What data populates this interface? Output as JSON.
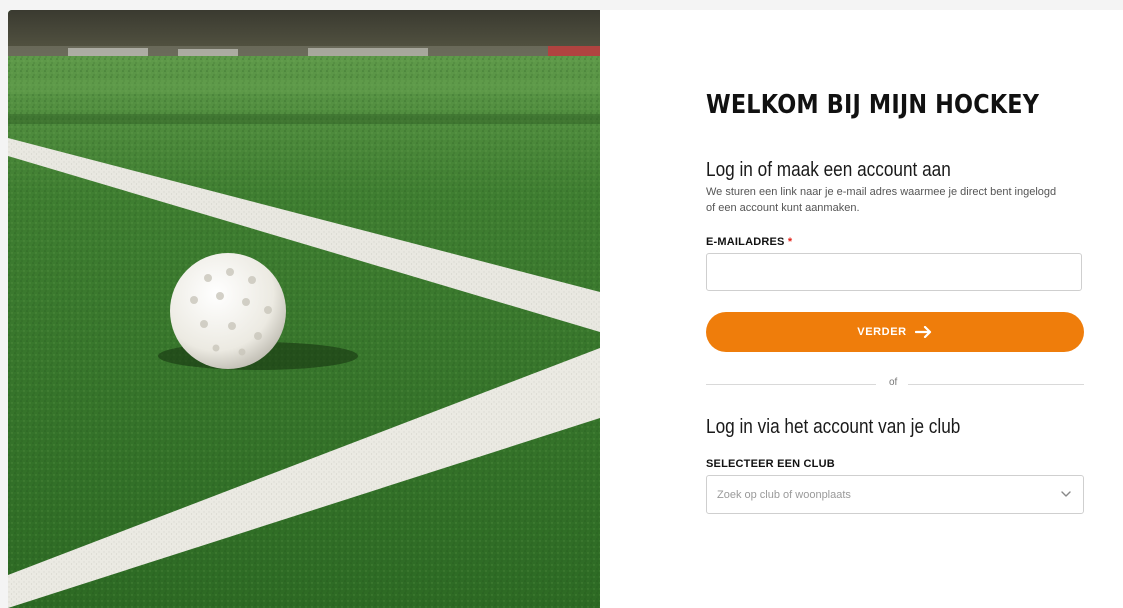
{
  "header": {
    "title": "WELKOM BIJ MIJN HOCKEY"
  },
  "email_login": {
    "heading": "Log in of maak een account aan",
    "description": "We sturen een link naar je e-mail adres waarmee je direct bent ingelogd of een account kunt aanmaken.",
    "email_label": "E-MAILADRES",
    "required_marker": "*",
    "email_value": "",
    "email_placeholder": "",
    "submit_label": "VERDER",
    "submit_icon": "arrow-right-icon"
  },
  "divider": {
    "label": "of"
  },
  "club_login": {
    "heading": "Log in via het account van je club",
    "select_label": "SELECTEER EEN CLUB",
    "select_placeholder": "Zoek op club of woonplaats",
    "select_icon": "chevron-down-icon"
  },
  "colors": {
    "accent": "#ef7d0b",
    "required": "#e2231a",
    "turf": "#2f6b28"
  }
}
